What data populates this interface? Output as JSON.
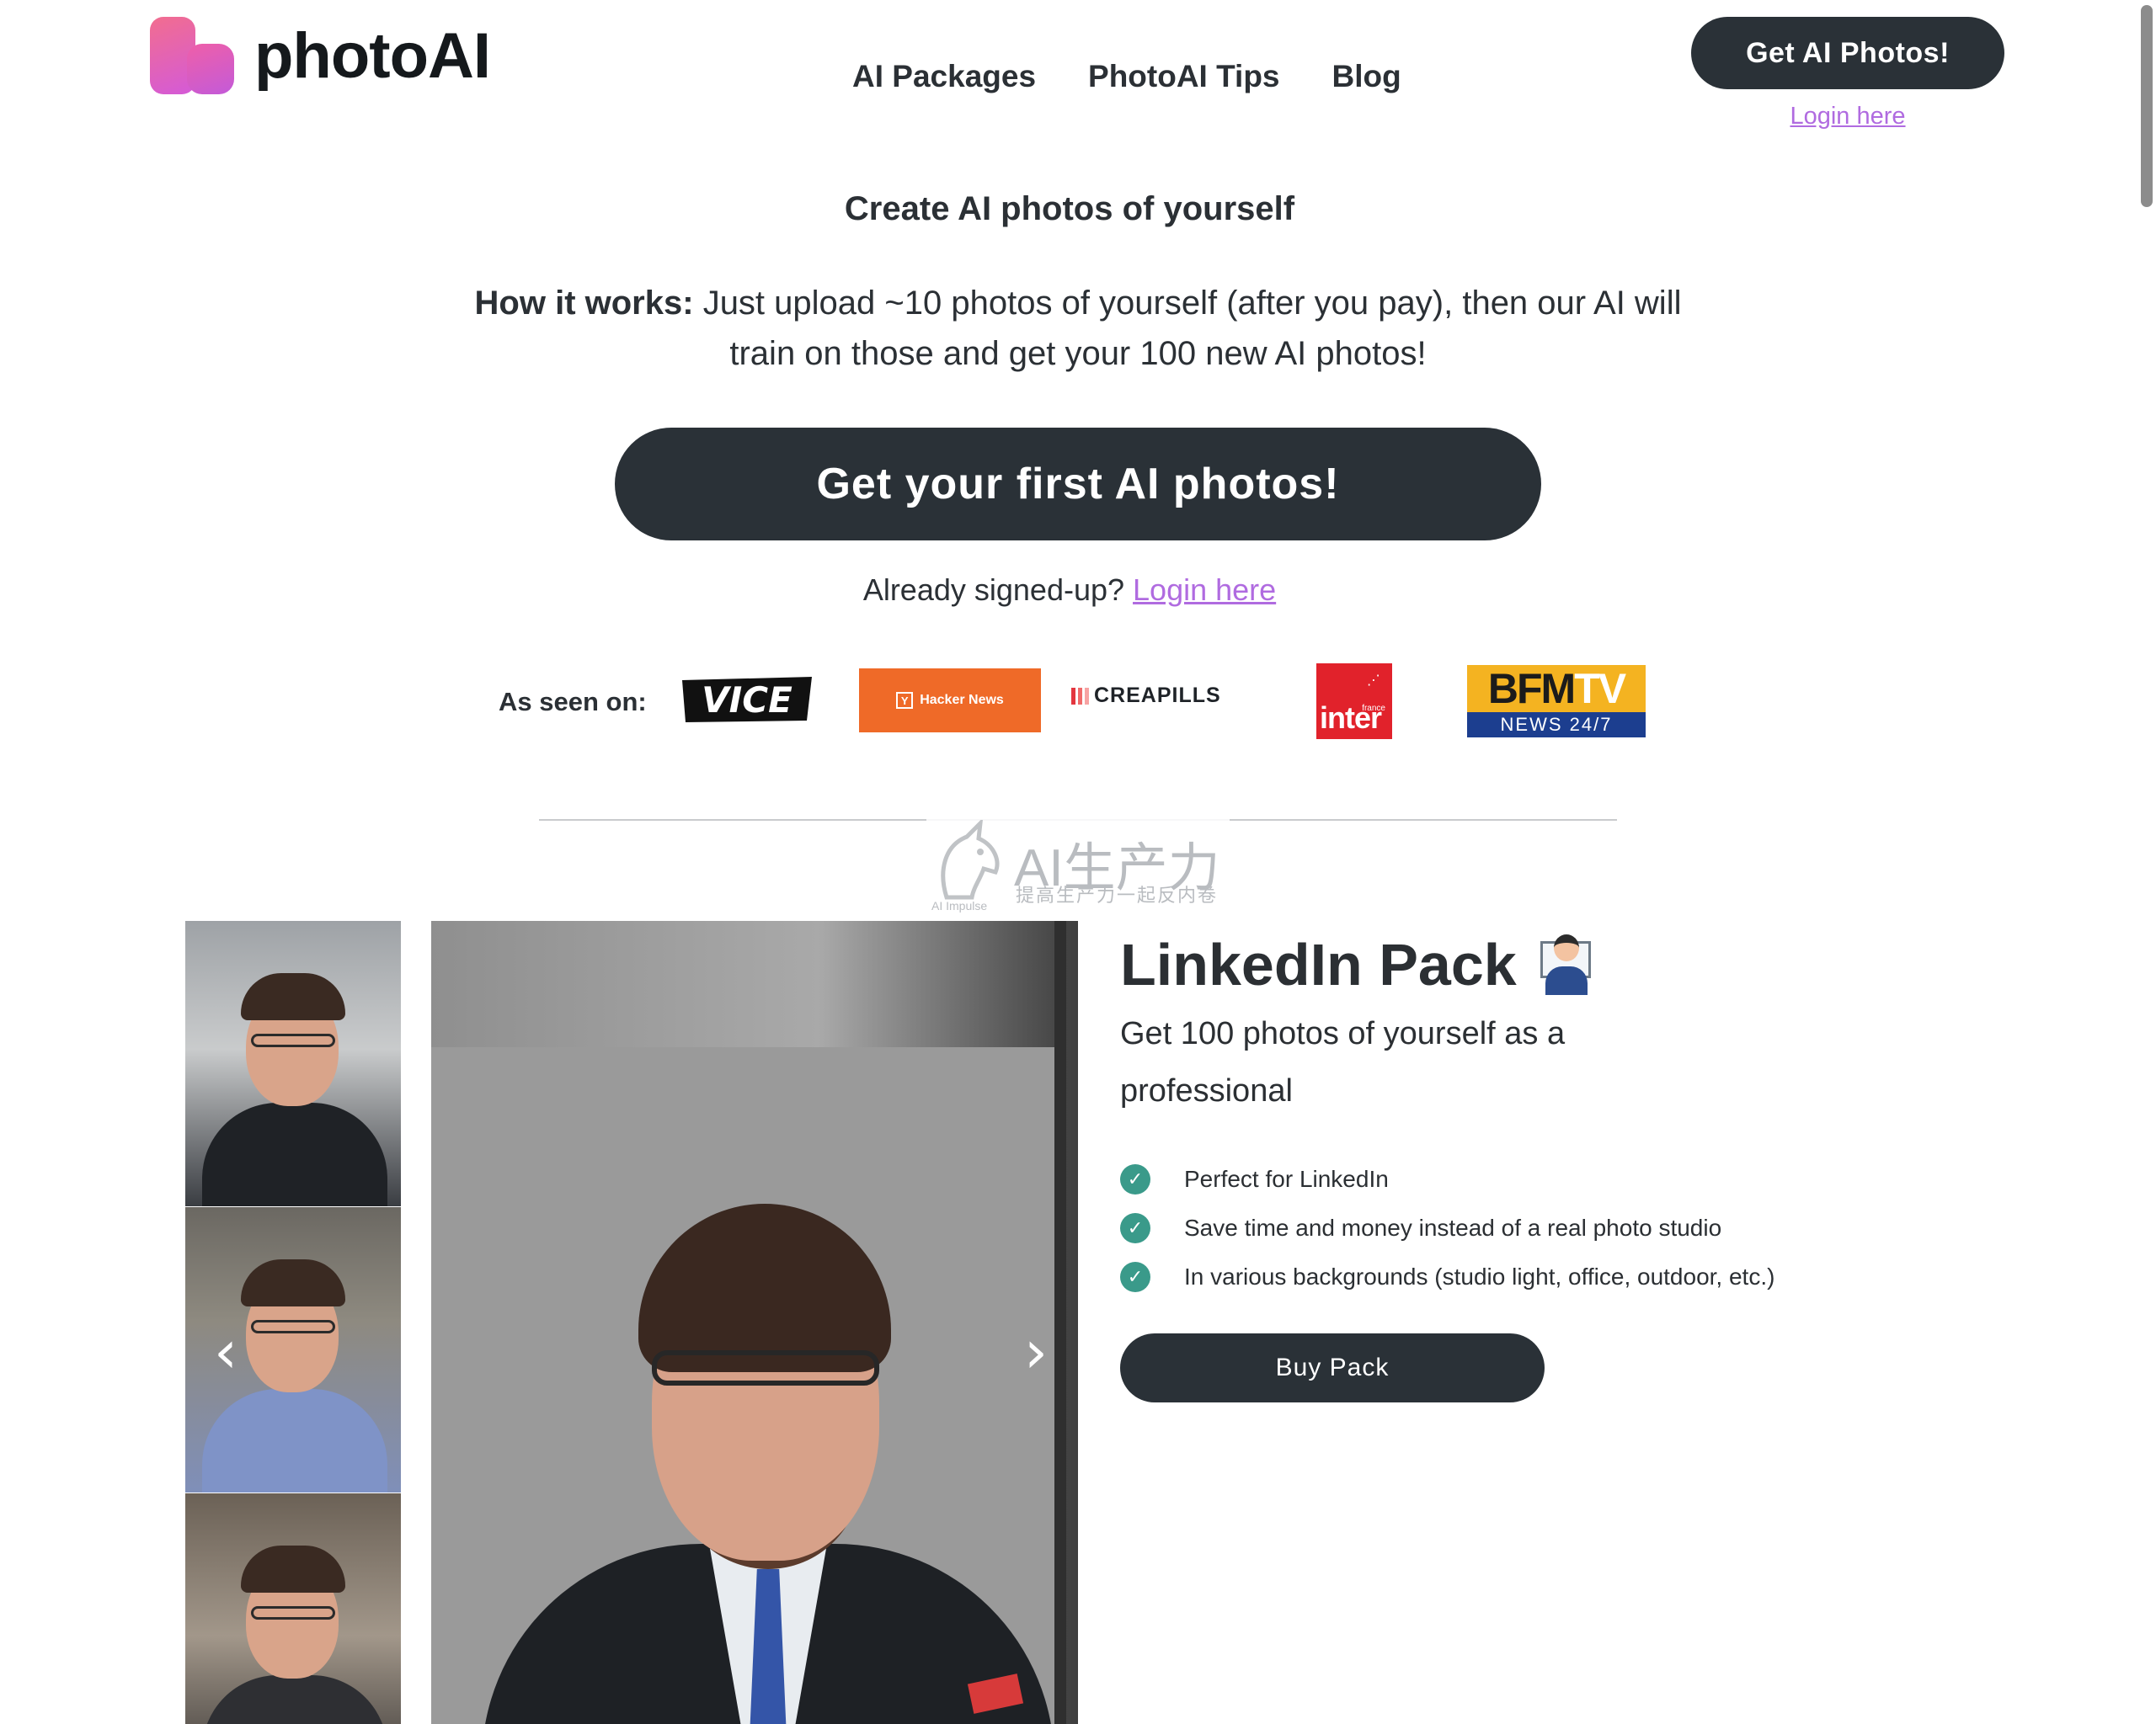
{
  "brand": {
    "name": "photoAI"
  },
  "nav": {
    "items": [
      "AI Packages",
      "PhotoAI Tips",
      "Blog"
    ]
  },
  "header": {
    "cta_label": "Get AI Photos!",
    "login_label": "Login here"
  },
  "hero": {
    "tagline": "Create AI photos of yourself",
    "how_label": "How it works:",
    "how_text": "Just upload ~10 photos of yourself (after you pay), then our AI will train on those and get your 100 new AI photos!",
    "cta_label": "Get your first AI photos!",
    "signed_prefix": "Already signed-up?",
    "signed_link": "Login here"
  },
  "press": {
    "label": "As seen on:",
    "logos": {
      "vice": "VICE",
      "hackernews": "Hacker News",
      "creapills": "CREAPILLS",
      "inter_small": "france",
      "inter": "inter",
      "bfm_main": "BFM",
      "bfm_tv": "TV",
      "bfm_sub": "NEWS 24/7"
    }
  },
  "watermark": {
    "title": "AI生产力",
    "subtitle": "提高生产力一起反内卷",
    "tiny": "AI Impulse"
  },
  "gallery": {
    "prev_label": "‹",
    "next_label": "›"
  },
  "pack": {
    "title": "LinkedIn Pack",
    "subtitle": "Get 100 photos of yourself as a professional",
    "features": [
      "Perfect for LinkedIn",
      "Save time and money instead of a real photo studio",
      "In various backgrounds (studio light, office, outdoor, etc.)"
    ],
    "buy_label": "Buy Pack"
  },
  "colors": {
    "dark": "#2a3137",
    "link": "#b06be0",
    "check": "#3a9a8a"
  }
}
